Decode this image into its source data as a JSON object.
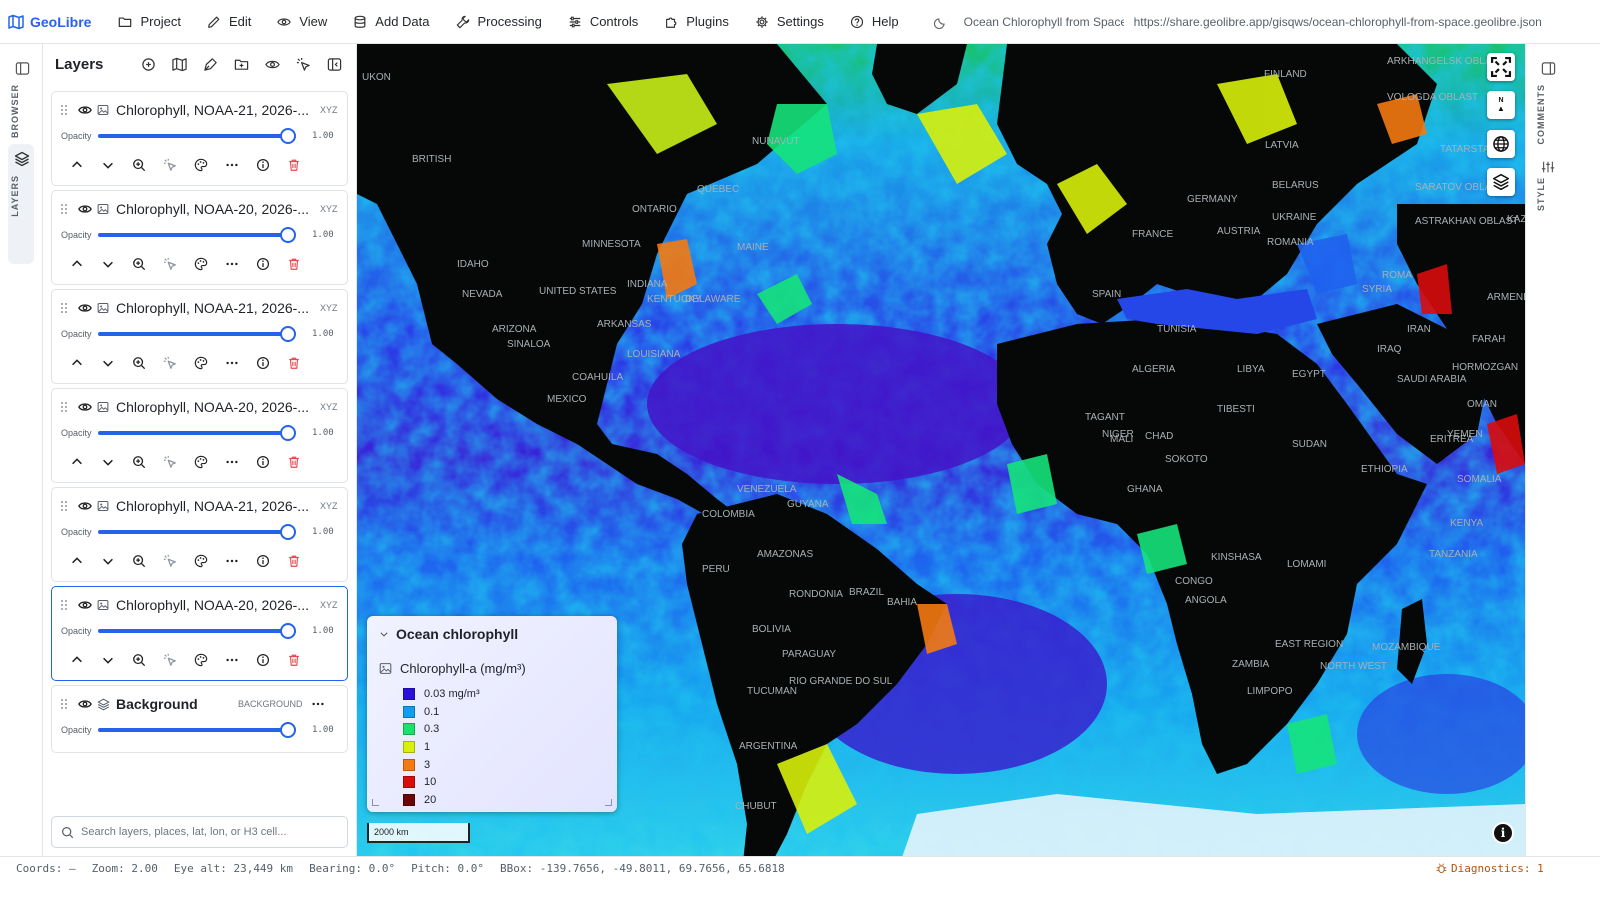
{
  "app": {
    "name": "GeoLibre",
    "doc_title": "Ocean Chlorophyll from Space",
    "doc_url": "https://share.geolibre.app/gisqws/ocean-chlorophyll-from-space.geolibre.json"
  },
  "menu": {
    "items": [
      {
        "label": "Project",
        "icon": "folder-icon"
      },
      {
        "label": "Edit",
        "icon": "pencil-icon"
      },
      {
        "label": "View",
        "icon": "eye-icon"
      },
      {
        "label": "Add Data",
        "icon": "database-icon"
      },
      {
        "label": "Processing",
        "icon": "wrench-icon"
      },
      {
        "label": "Controls",
        "icon": "sliders-icon"
      },
      {
        "label": "Plugins",
        "icon": "puzzle-icon"
      },
      {
        "label": "Settings",
        "icon": "gear-icon"
      },
      {
        "label": "Help",
        "icon": "help-circle-icon"
      }
    ]
  },
  "left_rail": {
    "browser_label": "BROWSER",
    "layers_label": "LAYERS"
  },
  "right_rail": {
    "comments_label": "COMMENTS",
    "style_label": "STYLE"
  },
  "layers_panel": {
    "title": "Layers",
    "opacity_label": "Opacity",
    "layers": [
      {
        "name": "Chlorophyll, NOAA-21, 2026-...",
        "type": "XYZ",
        "opacity": "1.00",
        "opacity_fraction": 1.0,
        "selected": false
      },
      {
        "name": "Chlorophyll, NOAA-20, 2026-...",
        "type": "XYZ",
        "opacity": "1.00",
        "opacity_fraction": 1.0,
        "selected": false
      },
      {
        "name": "Chlorophyll, NOAA-21, 2026-...",
        "type": "XYZ",
        "opacity": "1.00",
        "opacity_fraction": 1.0,
        "selected": false
      },
      {
        "name": "Chlorophyll, NOAA-20, 2026-...",
        "type": "XYZ",
        "opacity": "1.00",
        "opacity_fraction": 1.0,
        "selected": false
      },
      {
        "name": "Chlorophyll, NOAA-21, 2026-...",
        "type": "XYZ",
        "opacity": "1.00",
        "opacity_fraction": 1.0,
        "selected": false
      },
      {
        "name": "Chlorophyll, NOAA-20, 2026-...",
        "type": "XYZ",
        "opacity": "1.00",
        "opacity_fraction": 1.0,
        "selected": true
      }
    ],
    "background": {
      "name": "Background",
      "type": "BACKGROUND",
      "opacity": "1.00",
      "opacity_fraction": 1.0
    },
    "search_placeholder": "Search layers, places, lat, lon, or H3 cell..."
  },
  "legend": {
    "title": "Ocean chlorophyll",
    "subtitle": "Chlorophyll-a (mg/m³)",
    "items": [
      {
        "label": "0.03 mg/m³",
        "color": "#2a10d8"
      },
      {
        "label": "0.1",
        "color": "#0f9ef0"
      },
      {
        "label": "0.3",
        "color": "#1de26a"
      },
      {
        "label": "1",
        "color": "#d8f00a"
      },
      {
        "label": "3",
        "color": "#f47a12"
      },
      {
        "label": "10",
        "color": "#d90c0c"
      },
      {
        "label": "20",
        "color": "#6a0606"
      }
    ]
  },
  "map": {
    "scale_label": "2000 km",
    "compass_n": "N",
    "compass_a": "A",
    "place_labels": [
      "UKON",
      "BRITISH",
      "NUNAVUT",
      "ONTARIO",
      "QUEBEC",
      "MINNESOTA",
      "UNITED STATES",
      "IDAHO",
      "NEVADA",
      "ARIZONA",
      "INDIANA",
      "KENTUCKY",
      "ARKANSAS",
      "LOUISIANA",
      "DELAWARE",
      "MAINE",
      "MEXICO",
      "COAHUILA",
      "SINALOA",
      "VENEZUELA",
      "GUYANA",
      "COLOMBIA",
      "PERU",
      "BOLIVIA",
      "BRAZIL",
      "PARAGUAY",
      "ARGENTINA",
      "RIO GRANDE DO SUL",
      "BAHIA",
      "AMAZONAS",
      "RONDONIA",
      "TUCUMAN",
      "CHUBUT",
      "FINLAND",
      "LATVIA",
      "GERMANY",
      "AUSTRIA",
      "FRANCE",
      "SPAIN",
      "ROMANIA",
      "UKRAINE",
      "KAZAKHSTAN",
      "BELARUS",
      "ALGERIA",
      "LIBYA",
      "EGYPT",
      "TUNISIA",
      "NIGER",
      "CHAD",
      "SUDAN",
      "MALI",
      "GHANA",
      "TIBESTI",
      "YEMEN",
      "SOMALIA",
      "ETHIOPIA",
      "KENYA",
      "TANZANIA",
      "ANGOLA",
      "ZAMBIA",
      "LIMPOPO",
      "NORTH WEST",
      "MOZAMBIQUE",
      "IRAN",
      "SAUDI ARABIA",
      "OMAN",
      "EAST REGION",
      "SOKOTO",
      "KINSHASA",
      "TAGANT",
      "LOMAMI",
      "CONGO",
      "ERITREA",
      "IRAQ",
      "SYRIA",
      "ARKHANGELSK OBLAST",
      "VOLOGDA OBLAST",
      "TATARSTAN",
      "SARATOV OBLAST",
      "ASTRAKHAN OBLAST",
      "FARAH",
      "HORMOZGAN",
      "ARMENISTAN",
      "ROMA"
    ]
  },
  "status": {
    "coords": "Coords: —",
    "zoom": "Zoom: 2.00",
    "eye_alt": "Eye alt: 23,449 km",
    "bearing": "Bearing: 0.0°",
    "pitch": "Pitch: 0.0°",
    "bbox": "BBox: -139.7656, -49.8011, 69.7656, 65.6818",
    "diagnostics": "Diagnostics: 1"
  },
  "colors": {
    "accent": "#2563eb",
    "danger": "#e5484d",
    "warning": "#b45309"
  }
}
